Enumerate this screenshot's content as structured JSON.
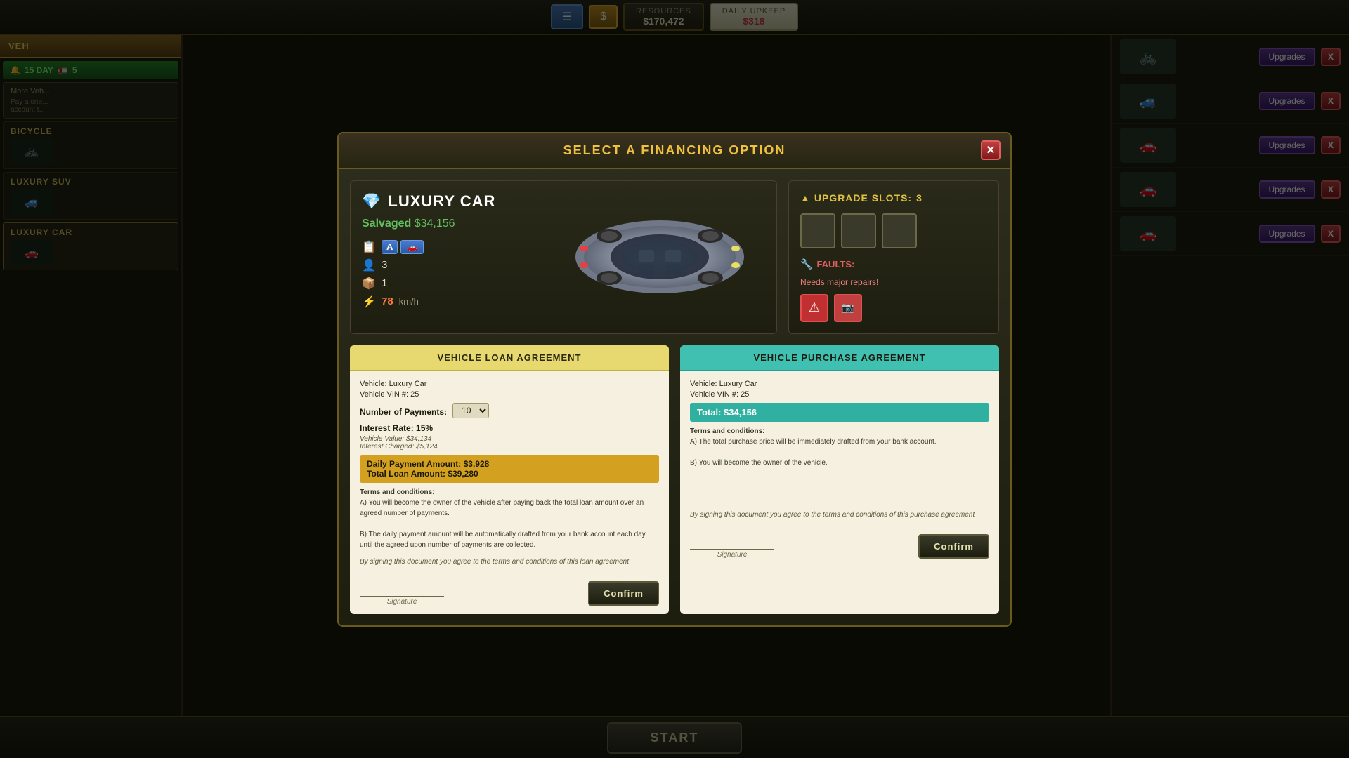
{
  "topbar": {
    "menu_icon": "☰",
    "money_icon": "$",
    "resources_label": "RESOURCES",
    "resources_value": "$170,472",
    "upkeep_label": "DAILY UPKEEP",
    "upkeep_value": "$318"
  },
  "bottombar": {
    "start_label": "START"
  },
  "modal": {
    "title": "SELECT A FINANCING OPTION",
    "close_icon": "✕",
    "vehicle": {
      "gem_icon": "💎",
      "name": "LUXURY CAR",
      "status_label": "Salvaged",
      "status_price": "$34,156",
      "badge_a": "A",
      "badge_car": "🚗",
      "seats": "3",
      "cargo": "1",
      "speed": "78",
      "speed_unit": "km/h"
    },
    "upgrade_slots": {
      "title": "UPGRADE SLOTS:",
      "count": "3",
      "slots": [
        1,
        2,
        3
      ],
      "faults_label": "FAULTS:",
      "faults_text": "Needs major repairs!",
      "fault_icons": [
        "🔴",
        "📷"
      ]
    },
    "loan": {
      "header": "VEHICLE LOAN AGREEMENT",
      "vehicle_label": "Vehicle:",
      "vehicle_value": "Luxury Car",
      "vin_label": "Vehicle VIN #:",
      "vin_value": "25",
      "payments_label": "Number of Payments:",
      "interest_label": "Interest Rate:",
      "interest_value": "15%",
      "vehicle_value_label": "Vehicle Value:",
      "vehicle_value_amount": "$34,134",
      "interest_charged_label": "Interest Charged:",
      "interest_charged_amount": "$5,124",
      "daily_payment_label": "Daily Payment Amount:",
      "daily_payment_value": "$3,928",
      "total_loan_label": "Total Loan Amount:",
      "total_loan_value": "$39,280",
      "terms_title": "Terms and conditions:",
      "terms_a": "A) You will become the owner of the vehicle after paying back the total loan amount over an agreed number of payments.",
      "terms_b": "B) The daily payment amount will be automatically drafted from your bank account each day until the agreed upon number of payments are collected.",
      "signing_text": "By signing this document you agree to the terms and conditions of this loan agreement",
      "signature_label": "Signature",
      "confirm_label": "Confirm"
    },
    "purchase": {
      "header": "VEHICLE PURCHASE AGREEMENT",
      "vehicle_label": "Vehicle:",
      "vehicle_value": "Luxury Car",
      "vin_label": "Vehicle VIN #:",
      "vin_value": "25",
      "total_label": "Total:",
      "total_value": "$34,156",
      "terms_title": "Terms and conditions:",
      "terms_a": "A) The total purchase price will be immediately drafted from your bank account.",
      "terms_b": "B) You will become the owner of the vehicle.",
      "signing_text": "By signing this document you agree to the terms and conditions of this purchase agreement",
      "signature_label": "Signature",
      "confirm_label": "Confirm"
    }
  },
  "sidebar": {
    "upgrades_label": "Upgrades",
    "x_label": "X",
    "rows": [
      {
        "id": 1,
        "icon": "🚲"
      },
      {
        "id": 2,
        "icon": "🚙"
      },
      {
        "id": 3,
        "icon": "🚗"
      },
      {
        "id": 4,
        "icon": "🚗"
      },
      {
        "id": 5,
        "icon": "🚗"
      }
    ]
  },
  "left_panel": {
    "veh_label": "VEH",
    "day_label": "15 DAY",
    "count_label": "5",
    "more_veh_text": "More Veh...",
    "pay_text": "Pay a one...\naccount t...",
    "items": [
      {
        "name": "BICYCLE",
        "icon": "🚲"
      },
      {
        "name": "LUXURY SUV",
        "icon": "🚙"
      },
      {
        "name": "LUXURY CAR",
        "icon": "🚗"
      }
    ]
  }
}
